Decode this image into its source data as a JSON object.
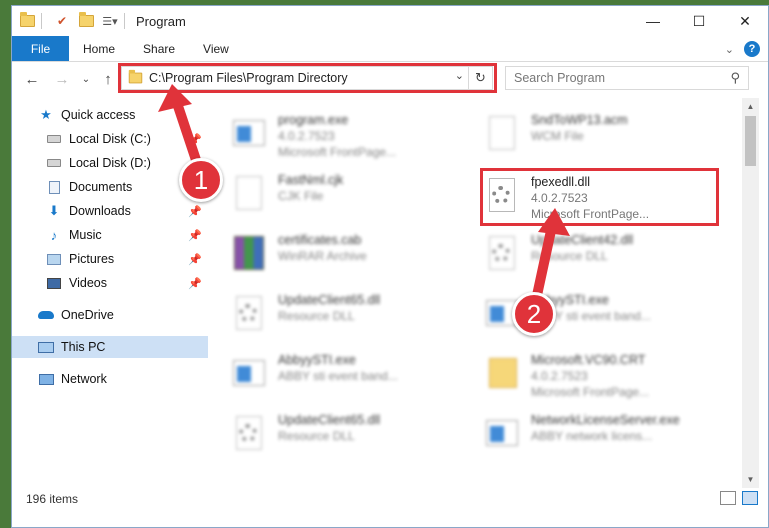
{
  "window": {
    "title": "Program"
  },
  "titlebar": {
    "minimize": "—",
    "maximize": "☐",
    "close": "✕"
  },
  "ribbon": {
    "tabs": [
      {
        "label": "File"
      },
      {
        "label": "Home"
      },
      {
        "label": "Share"
      },
      {
        "label": "View"
      }
    ]
  },
  "nav": {
    "address": "C:\\Program Files\\Program Directory",
    "search_placeholder": "Search Program"
  },
  "sidebar": {
    "items": [
      {
        "label": "Quick access",
        "icon": "star-icon",
        "pinned": false
      },
      {
        "label": "Local Disk (C:)",
        "icon": "drive-icon",
        "pinned": true
      },
      {
        "label": "Local Disk (D:)",
        "icon": "drive-icon",
        "pinned": false
      },
      {
        "label": "Documents",
        "icon": "documents-icon",
        "pinned": true
      },
      {
        "label": "Downloads",
        "icon": "downloads-icon",
        "pinned": true
      },
      {
        "label": "Music",
        "icon": "music-icon",
        "pinned": true
      },
      {
        "label": "Pictures",
        "icon": "pictures-icon",
        "pinned": true
      },
      {
        "label": "Videos",
        "icon": "videos-icon",
        "pinned": true
      },
      {
        "label": "OneDrive",
        "icon": "onedrive-icon",
        "pinned": false
      },
      {
        "label": "This PC",
        "icon": "this-pc-icon",
        "pinned": false,
        "selected": true
      },
      {
        "label": "Network",
        "icon": "network-icon",
        "pinned": false
      }
    ]
  },
  "files": [
    {
      "name": "program.exe",
      "line2": "4.0.2.7523",
      "line3": "Microsoft FrontPage...",
      "icon": "exe-icon",
      "blurred": true
    },
    {
      "name": "SndToWP13.acm",
      "line2": "WCM File",
      "line3": "",
      "icon": "page-icon",
      "blurred": true
    },
    {
      "name": "FastNml.cjk",
      "line2": "CJK File",
      "line3": "",
      "icon": "page-icon",
      "blurred": true
    },
    {
      "name": "fpexedll.dll",
      "line2": "4.0.2.7523",
      "line3": "Microsoft FrontPage...",
      "icon": "dll-gear-icon",
      "blurred": false
    },
    {
      "name": "certificates.cab",
      "line2": "WinRAR Archive",
      "line3": "",
      "icon": "rar-icon",
      "blurred": true
    },
    {
      "name": "UpdateClient42.dll",
      "line2": "Resource DLL",
      "line3": "",
      "icon": "dll-gear-icon",
      "blurred": true
    },
    {
      "name": "UpdateClient65.dll",
      "line2": "Resource DLL",
      "line3": "",
      "icon": "dll-gear-icon",
      "blurred": true
    },
    {
      "name": "AbbyySTI.exe",
      "line2": "ABBY sti event band...",
      "line3": "",
      "icon": "exe-icon",
      "blurred": true
    },
    {
      "name": "AbbyySTI.exe",
      "line2": "ABBY sti event band...",
      "line3": "",
      "icon": "exe-icon",
      "blurred": true
    },
    {
      "name": "Microsoft.VC90.CRT",
      "line2": "4.0.2.7523",
      "line3": "Microsoft FrontPage...",
      "icon": "folder-icon",
      "blurred": true
    },
    {
      "name": "UpdateClient65.dll",
      "line2": "Resource DLL",
      "line3": "",
      "icon": "dll-gear-icon",
      "blurred": true
    },
    {
      "name": "NetworkLicenseServer.exe",
      "line2": "ABBY network licens...",
      "line3": "",
      "icon": "exe-icon",
      "blurred": true
    }
  ],
  "status": {
    "count": "196 items"
  },
  "annotations": {
    "step1": "1",
    "step2": "2"
  }
}
